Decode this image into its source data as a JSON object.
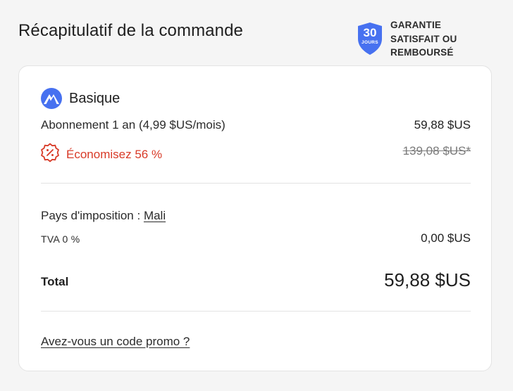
{
  "header": {
    "title": "Récapitulatif de la commande",
    "guarantee": {
      "days": "30",
      "days_label": "JOURS",
      "line1": "GARANTIE",
      "line2": "SATISFAIT OU",
      "line3": "REMBOURSÉ"
    }
  },
  "order": {
    "plan_name": "Basique",
    "subscription_label": "Abonnement 1 an (4,99 $US/mois)",
    "subscription_price": "59,88 $US",
    "savings_label": "Économisez 56 %",
    "original_price": "139,08 $US*"
  },
  "tax": {
    "country_label": "Pays d'imposition :",
    "country_value": "Mali",
    "vat_label": "TVA 0 %",
    "vat_amount": "0,00 $US"
  },
  "total": {
    "label": "Total",
    "value": "59,88 $US"
  },
  "promo": {
    "link_label": "Avez-vous un code promo ?"
  },
  "colors": {
    "accent_blue": "#4771f0",
    "savings_red": "#d83a27",
    "background": "#f5f5f5"
  },
  "icons": {
    "guarantee": "shield-badge-icon",
    "plan": "mountain-logo-icon",
    "savings": "discount-badge-icon"
  }
}
